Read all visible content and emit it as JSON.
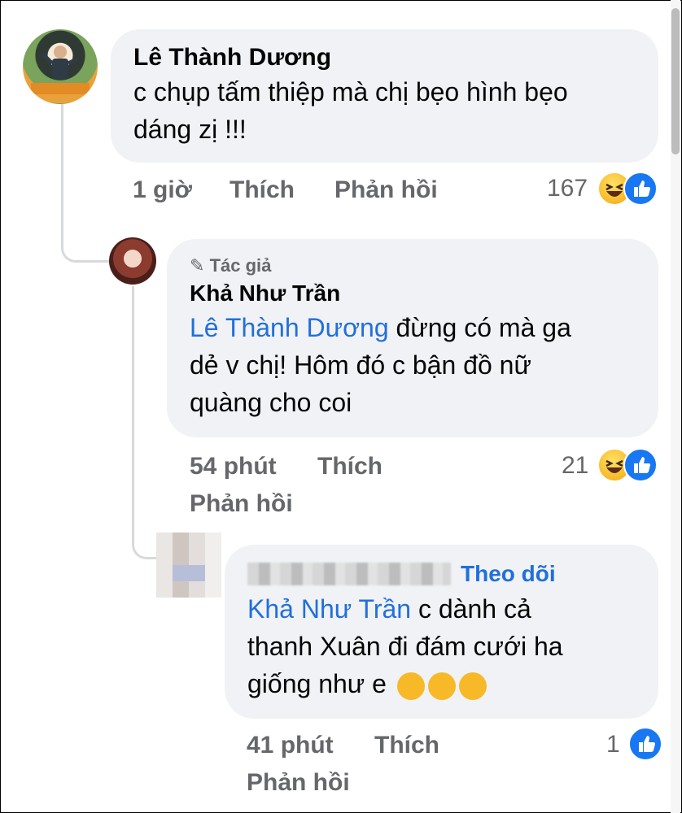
{
  "comments": [
    {
      "author": "Lê Thành Dương",
      "text_line1": "c chụp tấm thiệp mà chị bẹo hình bẹo",
      "text_line2": "dáng zị !!!",
      "time": "1 giờ",
      "like": "Thích",
      "reply": "Phản hồi",
      "reaction_count": "167",
      "reactions": [
        "haha-icon",
        "like-icon"
      ]
    },
    {
      "badge": "Tác giả",
      "author": "Khả Như Trần",
      "mention": "Lê Thành Dương",
      "text_line1": " đừng có mà ga",
      "text_line2": "dẻ v chị! Hôm đó c bận đồ nữ",
      "text_line3": "quàng cho coi",
      "time": "54 phút",
      "like": "Thích",
      "reply": "Phản hồi",
      "reaction_count": "21",
      "reactions": [
        "haha-icon",
        "like-icon"
      ]
    },
    {
      "follow": "Theo dõi",
      "mention": "Khả Như Trần",
      "text_line1": " c dành cả",
      "text_line2": "thanh Xuân đi đám cưới ha",
      "text_line3": "giống như e",
      "emojis": [
        "rolling-laugh-emoji",
        "rolling-laugh-emoji",
        "rolling-laugh-emoji"
      ],
      "time": "41 phút",
      "like": "Thích",
      "reply": "Phản hồi",
      "reaction_count": "1",
      "reactions": [
        "like-icon"
      ]
    }
  ],
  "colors": {
    "bubble": "#f0f2f5",
    "mention": "#216fdb",
    "meta": "#65676b",
    "like_blue": "#1877f2",
    "haha_yellow": "#f7b928"
  }
}
